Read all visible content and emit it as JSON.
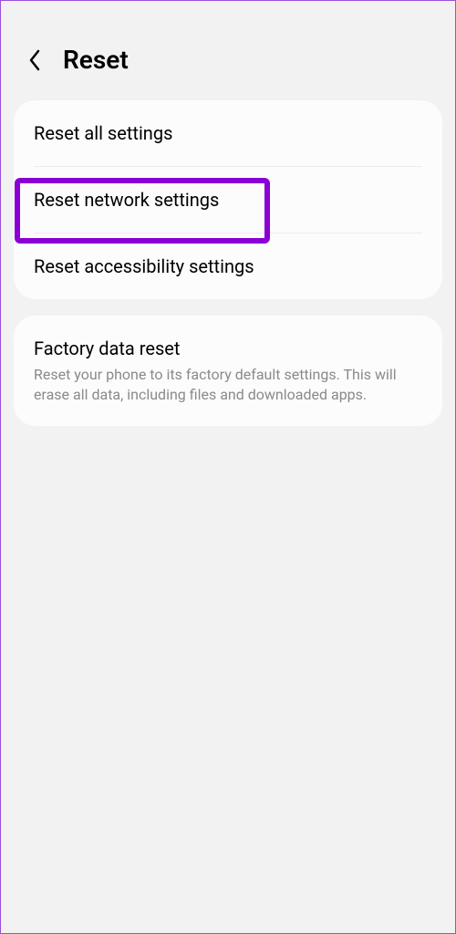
{
  "header": {
    "title": "Reset"
  },
  "group1": {
    "item1": {
      "title": "Reset all settings"
    },
    "item2": {
      "title": "Reset network settings"
    },
    "item3": {
      "title": "Reset accessibility settings"
    }
  },
  "group2": {
    "item1": {
      "title": "Factory data reset",
      "description": "Reset your phone to its factory default settings. This will erase all data, including files and downloaded apps."
    }
  }
}
